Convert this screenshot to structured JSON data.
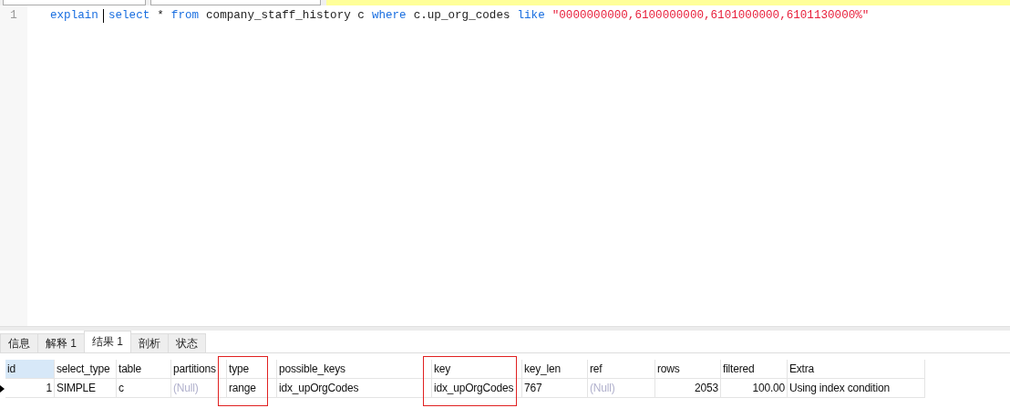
{
  "editor": {
    "lines": [
      {
        "number": "1",
        "tokens": [
          {
            "kind": "keyword",
            "text": "explain"
          },
          {
            "kind": "cursor"
          },
          {
            "kind": "keyword",
            "text": "select"
          },
          {
            "kind": "plain",
            "text": "*"
          },
          {
            "kind": "keyword",
            "text": "from"
          },
          {
            "kind": "plain",
            "text": "company_staff_history c"
          },
          {
            "kind": "keyword",
            "text": "where"
          },
          {
            "kind": "plain",
            "text": "c.up_org_codes"
          },
          {
            "kind": "keyword",
            "text": "like"
          },
          {
            "kind": "string",
            "text": "\"0000000000,6100000000,6101000000,6101130000%\""
          }
        ]
      }
    ]
  },
  "tabs": [
    {
      "label": "信息",
      "selected": false
    },
    {
      "label": "解释 1",
      "selected": false
    },
    {
      "label": "结果 1",
      "selected": true
    },
    {
      "label": "剖析",
      "selected": false
    },
    {
      "label": "状态",
      "selected": false
    }
  ],
  "table": {
    "columns": [
      {
        "label": "id",
        "kind": "number",
        "selected": true,
        "highlighted": false
      },
      {
        "label": "select_type",
        "kind": "text",
        "selected": false,
        "highlighted": false
      },
      {
        "label": "table",
        "kind": "text",
        "selected": false,
        "highlighted": false
      },
      {
        "label": "partitions",
        "kind": "text",
        "selected": false,
        "highlighted": false
      },
      {
        "label": "type",
        "kind": "text",
        "selected": false,
        "highlighted": true
      },
      {
        "label": "possible_keys",
        "kind": "text",
        "selected": false,
        "highlighted": false
      },
      {
        "label": "key",
        "kind": "text",
        "selected": false,
        "highlighted": true
      },
      {
        "label": "key_len",
        "kind": "text",
        "selected": false,
        "highlighted": false
      },
      {
        "label": "ref",
        "kind": "text",
        "selected": false,
        "highlighted": false
      },
      {
        "label": "rows",
        "kind": "number",
        "selected": false,
        "highlighted": false
      },
      {
        "label": "filtered",
        "kind": "number",
        "selected": false,
        "highlighted": false
      },
      {
        "label": "Extra",
        "kind": "text",
        "selected": false,
        "highlighted": false
      }
    ],
    "rows": [
      {
        "current": true,
        "cells": [
          {
            "text": "1",
            "null": false
          },
          {
            "text": "SIMPLE",
            "null": false
          },
          {
            "text": "c",
            "null": false
          },
          {
            "text": "(Null)",
            "null": true
          },
          {
            "text": "range",
            "null": false
          },
          {
            "text": "idx_upOrgCodes",
            "null": false
          },
          {
            "text": "idx_upOrgCodes",
            "null": false
          },
          {
            "text": "767",
            "null": false
          },
          {
            "text": "(Null)",
            "null": true
          },
          {
            "text": "2053",
            "null": false
          },
          {
            "text": "100.00",
            "null": false
          },
          {
            "text": "Using index condition",
            "null": false
          }
        ]
      }
    ]
  }
}
